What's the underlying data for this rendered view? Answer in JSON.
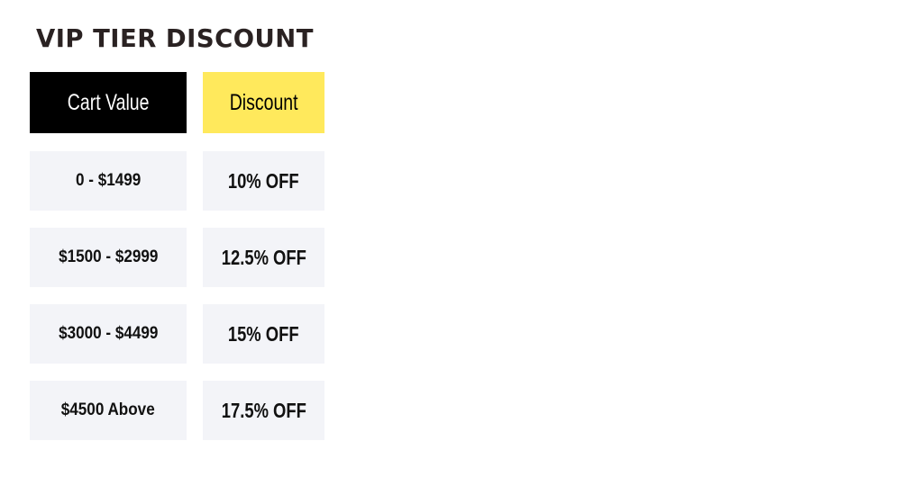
{
  "title": "VIP TIER DISCOUNT",
  "table": {
    "headers": [
      "Cart Value",
      "Discount"
    ],
    "rows": [
      {
        "cart_value": "0 - $1499",
        "discount": "10% OFF"
      },
      {
        "cart_value": "$1500 - $2999",
        "discount": "12.5% OFF"
      },
      {
        "cart_value": "$3000 - $4499",
        "discount": "15% OFF"
      },
      {
        "cart_value": "$4500 Above",
        "discount": "17.5% OFF"
      }
    ]
  },
  "colors": {
    "header_dark": "#000000",
    "header_accent": "#ffe95c",
    "row_background": "#f3f4f8",
    "title_text": "#2a2222"
  }
}
